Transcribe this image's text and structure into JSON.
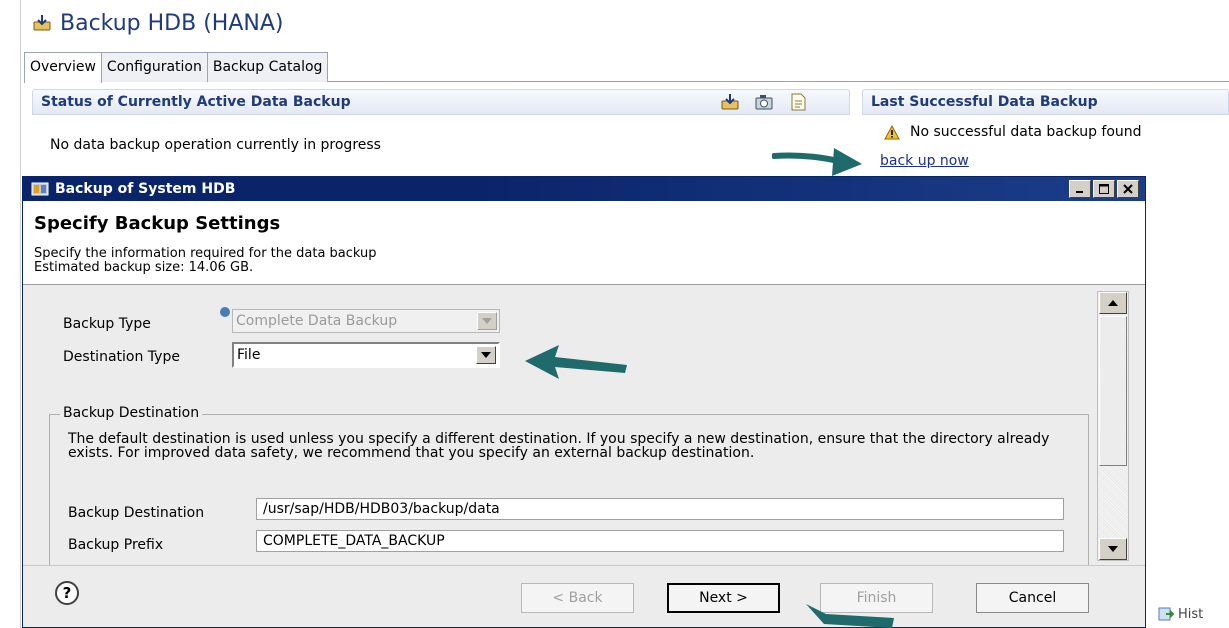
{
  "app": {
    "title": "Backup HDB (HANA)",
    "tabs": [
      {
        "label": "Overview",
        "active": true
      },
      {
        "label": "Configuration",
        "active": false
      },
      {
        "label": "Backup Catalog",
        "active": false
      }
    ]
  },
  "status_section": {
    "title": "Status of Currently Active Data Backup",
    "message": "No data backup operation currently in progress"
  },
  "last_section": {
    "title": "Last Successful Data Backup",
    "message": "No successful data backup found",
    "link": "back up now"
  },
  "dialog": {
    "title": "Backup of System HDB",
    "heading": "Specify Backup Settings",
    "description": "Specify the information required for the data backup",
    "estimated_size": "Estimated backup size: 14.06 GB.",
    "backup_type_label": "Backup Type",
    "backup_type_value": "Complete Data Backup",
    "destination_type_label": "Destination Type",
    "destination_type_value": "File",
    "group_title": "Backup Destination",
    "group_text": "The default destination is used unless you specify a different destination. If you specify a new destination, ensure that the directory already exists. For improved data safety, we recommend that you specify an external backup destination.",
    "destination_label": "Backup Destination",
    "destination_value": "/usr/sap/HDB/HDB03/backup/data",
    "prefix_label": "Backup Prefix",
    "prefix_value": "COMPLETE_DATA_BACKUP",
    "buttons": {
      "back": "< Back",
      "next": "Next >",
      "finish": "Finish",
      "cancel": "Cancel"
    },
    "help": "?"
  },
  "history_label": "Hist",
  "colors": {
    "title_blue": "#1f3b7a",
    "dialog_titlebar": "#0a246a",
    "annotation_arrow": "#1f6b6b"
  }
}
